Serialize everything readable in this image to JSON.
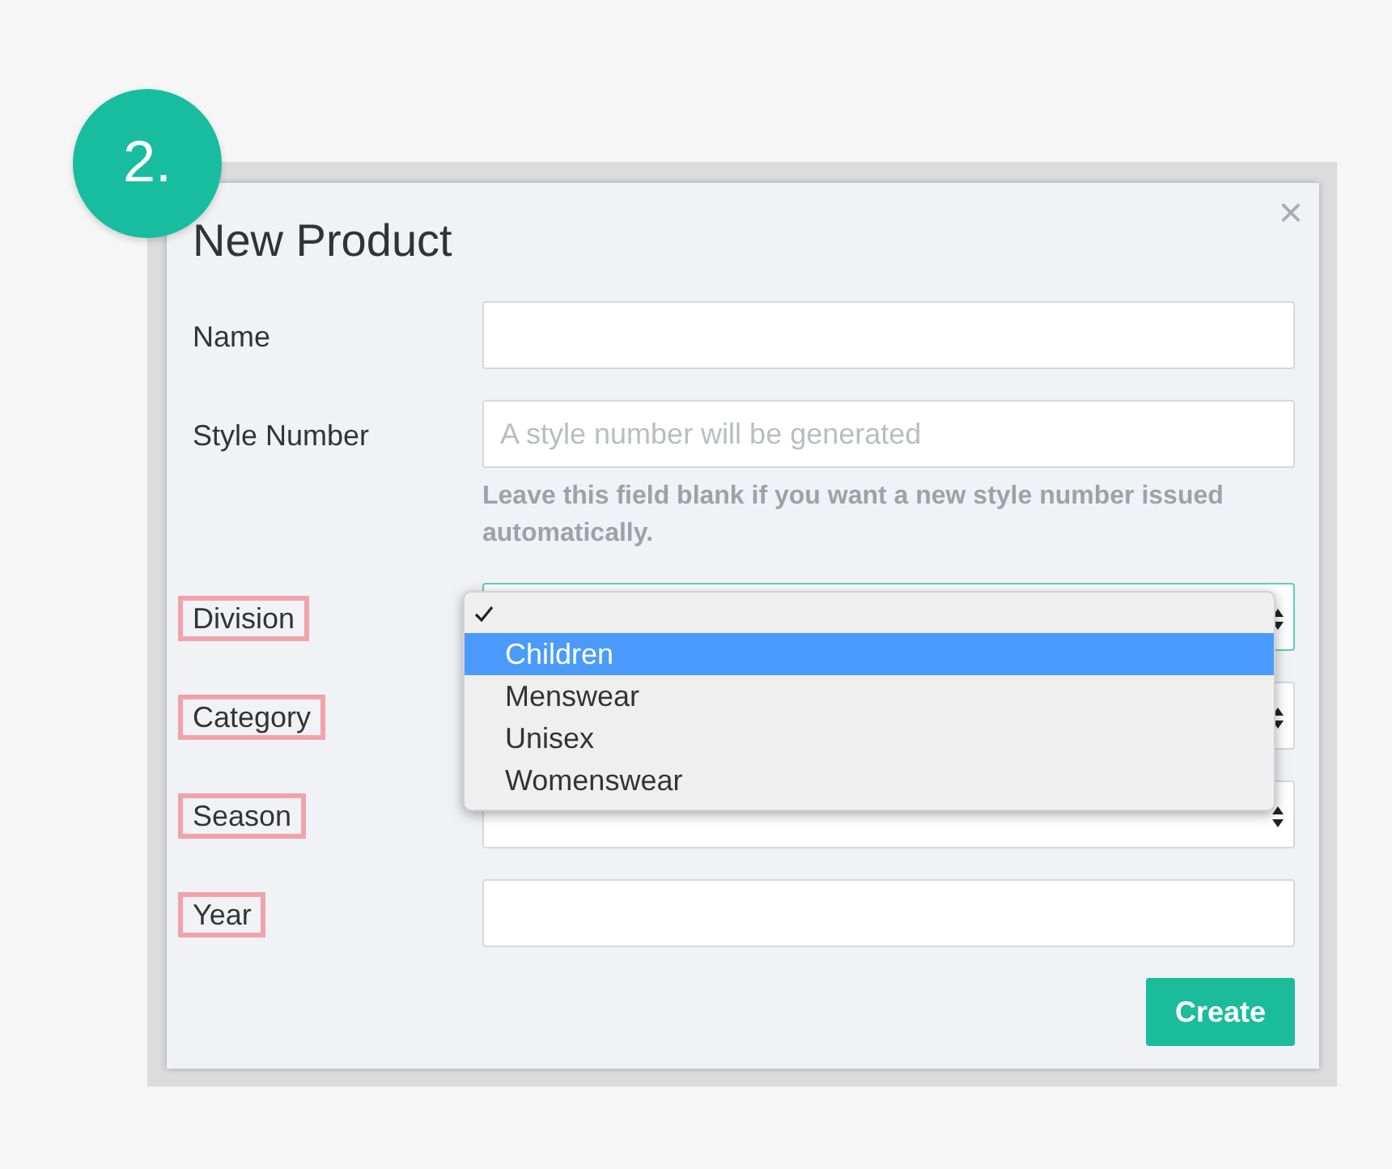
{
  "step_badge": "2.",
  "dialog": {
    "title": "New Product",
    "close": "×",
    "fields": [
      {
        "label": "Name",
        "kind": "text",
        "highlighted": false,
        "focused": false
      },
      {
        "label": "Style Number",
        "kind": "text",
        "placeholder": "A style number will be generated",
        "help": "Leave this field blank if you want a new style number issued automatically.",
        "highlighted": false,
        "focused": false
      },
      {
        "label": "Division",
        "kind": "select",
        "highlighted": true,
        "focused": true,
        "options": [
          {
            "checked": true,
            "selected": false
          },
          {
            "label": "Children",
            "checked": false,
            "selected": true
          },
          {
            "label": "Menswear",
            "checked": false,
            "selected": false
          },
          {
            "label": "Unisex",
            "checked": false,
            "selected": false
          },
          {
            "label": "Womenswear",
            "checked": false,
            "selected": false
          }
        ]
      },
      {
        "label": "Category",
        "kind": "select",
        "highlighted": true,
        "focused": false
      },
      {
        "label": "Season",
        "kind": "select",
        "highlighted": true,
        "focused": false
      },
      {
        "label": "Year",
        "kind": "text",
        "highlighted": true,
        "focused": false
      }
    ],
    "submit": "Create"
  }
}
